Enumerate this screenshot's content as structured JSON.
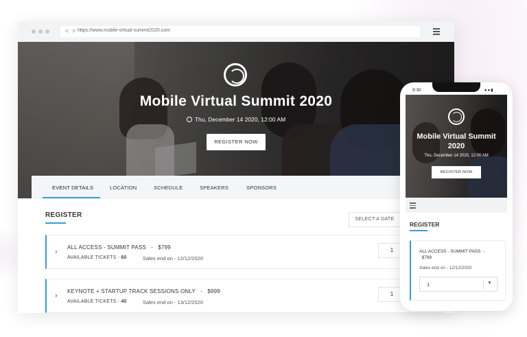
{
  "browser": {
    "url": "https://www.mobile-virtual-summit2020.com",
    "nav": "< >"
  },
  "event": {
    "title": "Mobile Virtual Summit 2020",
    "date": "Thu, December 14 2020, 12:00 AM",
    "register_button": "REGISTER NOW"
  },
  "tabs": [
    "EVENT DETAILS",
    "LOCATION",
    "SCHEDULE",
    "SPEAKERS",
    "SPONSORS"
  ],
  "register": {
    "title": "REGISTER",
    "select_date": "SELECT A DATE",
    "tickets": [
      {
        "name": "ALL ACCESS - SUMMIT PASS",
        "price": "$799",
        "available_label": "AVAILABLE TICKETS",
        "available": "60",
        "sales_end": "Sales end on - 12/12/2020",
        "qty": "1"
      },
      {
        "name": "KEYNOTE + STARTUP TRACK SESSIONS ONLY",
        "price": "$999",
        "available_label": "AVAILABLE TICKETS",
        "available": "40",
        "sales_end": "Sales end on - 13/12/2020",
        "qty": "1"
      }
    ]
  },
  "phone": {
    "time": "9:30",
    "title_line1": "Mobile Virtual Summit",
    "title_line2": "2020",
    "date": "Thu, December 14 2020, 12:00 AM",
    "register_button": "REGISTER NOW",
    "register_title": "REGISTER",
    "ticket_name": "ALL ACCESS - SUMMIT PASS",
    "ticket_price": "$799",
    "sales_end": "Sales end on - 12/12/2020",
    "qty": "1"
  },
  "colors": {
    "accent": "#2f9fd8",
    "tab_bar": "#f4f5f6"
  }
}
